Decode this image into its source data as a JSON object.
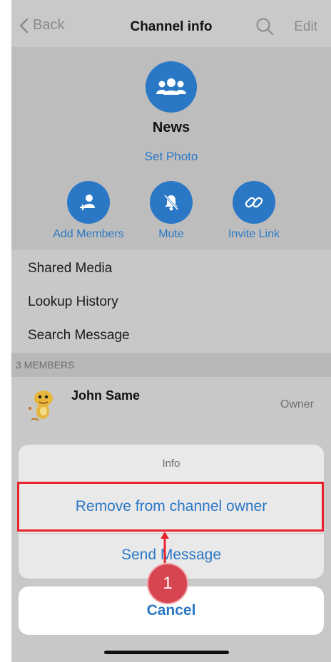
{
  "nav": {
    "back_label": "Back",
    "title": "Channel info",
    "edit_label": "Edit"
  },
  "channel": {
    "name": "News",
    "set_photo": "Set Photo"
  },
  "actions": [
    {
      "label": "Add Members",
      "icon": "add-person-icon"
    },
    {
      "label": "Mute",
      "icon": "bell-slash-icon"
    },
    {
      "label": "Invite Link",
      "icon": "link-icon"
    }
  ],
  "menu": {
    "shared_media": "Shared Media",
    "lookup_history": "Lookup History",
    "search_message": "Search Message"
  },
  "members": {
    "header": "3 MEMBERS",
    "items": [
      {
        "name": "John Same",
        "role": "Owner"
      }
    ]
  },
  "sheet": {
    "title": "Info",
    "remove_owner": "Remove from channel owner",
    "send_message": "Send Message",
    "cancel": "Cancel"
  },
  "annotation": {
    "step": "1"
  },
  "colors": {
    "accent": "#2a78c5",
    "highlight": "#e8232c",
    "badge": "#d64550"
  }
}
